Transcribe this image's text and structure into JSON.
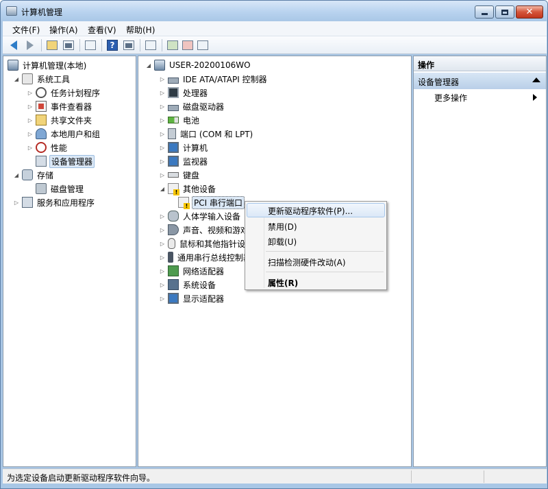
{
  "window": {
    "title": "计算机管理",
    "minimize_label": "",
    "maximize_label": "",
    "close_label": "✕"
  },
  "menubar": {
    "items": [
      "文件(F)",
      "操作(A)",
      "查看(V)",
      "帮助(H)"
    ]
  },
  "toolbar": {
    "buttons": [
      "back-icon",
      "forward-icon",
      "up-folder-icon",
      "show-hide-tree-icon",
      "properties-icon",
      "help-icon",
      "show-action-pane-icon",
      "scan-hardware-icon",
      "update-driver-icon",
      "uninstall-icon",
      "disable-icon"
    ]
  },
  "left_tree": {
    "root": "计算机管理(本地)",
    "system_tools": "系统工具",
    "task_scheduler": "任务计划程序",
    "event_viewer": "事件查看器",
    "shared_folders": "共享文件夹",
    "local_users": "本地用户和组",
    "performance": "性能",
    "device_manager": "设备管理器",
    "storage": "存储",
    "disk_management": "磁盘管理",
    "services": "服务和应用程序"
  },
  "device_tree": {
    "computer_name": "USER-20200106WO",
    "ide": "IDE ATA/ATAPI 控制器",
    "processors": "处理器",
    "disk_drives": "磁盘驱动器",
    "batteries": "电池",
    "ports": "端口 (COM 和 LPT)",
    "computer": "计算机",
    "monitors": "监视器",
    "keyboards": "键盘",
    "other_devices": "其他设备",
    "pci_serial": "PCI 串行端口",
    "hid": "人体学输入设备",
    "sound": "声音、视频和游戏控制器",
    "mice": "鼠标和其他指针设备",
    "usb": "通用串行总线控制器",
    "network": "网络适配器",
    "system_devices": "系统设备",
    "display": "显示适配器"
  },
  "actions": {
    "header": "操作",
    "group": "设备管理器",
    "more": "更多操作"
  },
  "context_menu": {
    "update_driver": "更新驱动程序软件(P)...",
    "disable": "禁用(D)",
    "uninstall": "卸载(U)",
    "scan": "扫描检测硬件改动(A)",
    "properties": "属性(R)"
  },
  "status": {
    "text": "为选定设备启动更新驱动程序软件向导。"
  }
}
